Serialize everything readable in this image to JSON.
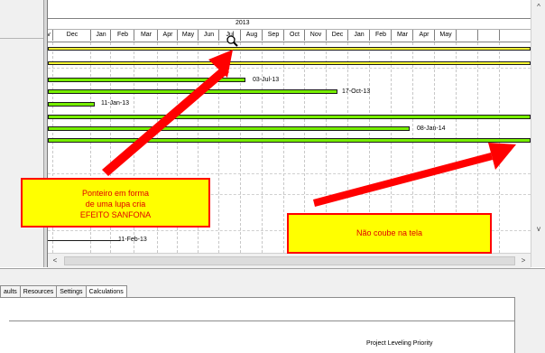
{
  "timescale": {
    "year": "2013",
    "months": [
      "v",
      "Dec",
      "Jan",
      "Feb",
      "Mar",
      "Apr",
      "May",
      "Jun",
      "Jul",
      "Aug",
      "Sep",
      "Oct",
      "Nov",
      "Dec",
      "Jan",
      "Feb",
      "Mar",
      "Apr",
      "May"
    ]
  },
  "bars": {
    "label_1": "03-Jul-13",
    "label_2": "17-Oct-13",
    "label_3": "11-Jan-13",
    "label_4": "08-Jan-14",
    "label_5": "11-Feb-13"
  },
  "callouts": {
    "left": "Ponteiro em forma\nde uma lupa cria\nEFEITO SANFONA",
    "right": "Não coube na tela"
  },
  "tabs": [
    "aults",
    "Resources",
    "Settings",
    "Calculations"
  ],
  "bottom": {
    "leveling_label": "Project Leveling Priority"
  },
  "scroll": {
    "up": "^",
    "down": "v",
    "left": "<",
    "right": ">"
  },
  "icons": {
    "cursor": "magnifier-icon"
  },
  "colors": {
    "bar": "#76ee00",
    "milestone_bar": "#ffff33",
    "arrow": "#ff0000",
    "callout_bg": "#ffff00"
  }
}
